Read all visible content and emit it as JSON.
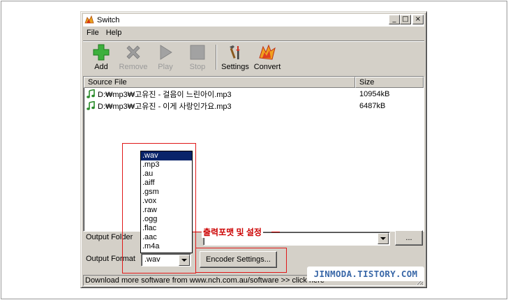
{
  "window": {
    "title": "Switch",
    "minimize_glyph": "_",
    "maximize_glyph": "□",
    "close_glyph": "×"
  },
  "menu": [
    "File",
    "Help"
  ],
  "toolbar": {
    "add": "Add",
    "remove": "Remove",
    "play": "Play",
    "stop": "Stop",
    "settings": "Settings",
    "convert": "Convert"
  },
  "file_list": {
    "columns": [
      "Source File",
      "Size"
    ],
    "rows": [
      {
        "name": "D:₩mp3₩고유진 - 걸음이 느린아이.mp3",
        "size": "10954kB"
      },
      {
        "name": "D:₩mp3₩고유진 - 이게 사랑인가요.mp3",
        "size": "6487kB"
      }
    ]
  },
  "output": {
    "folder_label": "Output Folder",
    "folder_value": "",
    "browse_label": "...",
    "format_label": "Output Format",
    "format_value": ".wav",
    "encoder_button": "Encoder Settings..."
  },
  "format_options": [
    ".wav",
    ".mp3",
    ".au",
    ".aiff",
    ".gsm",
    ".vox",
    ".raw",
    ".ogg",
    ".flac",
    ".aac",
    ".m4a"
  ],
  "status_text": "Download more software from www.nch.com.au/software >> click here",
  "annotation_label": "출력포맷 및 설정",
  "watermark": "JINMODA.TISTORY.COM",
  "colors": {
    "window_face": "#d4d0c8",
    "selection": "#0a246a",
    "annotation": "#e01818",
    "watermark": "#3a68a8",
    "add_icon": "#3db03d"
  },
  "icons": {
    "app": "switch-app-icon",
    "add": "plus-icon",
    "remove": "x-icon",
    "play": "play-icon",
    "stop": "stop-icon",
    "settings": "tools-icon",
    "convert": "convert-icon",
    "file": "music-note-icon"
  }
}
